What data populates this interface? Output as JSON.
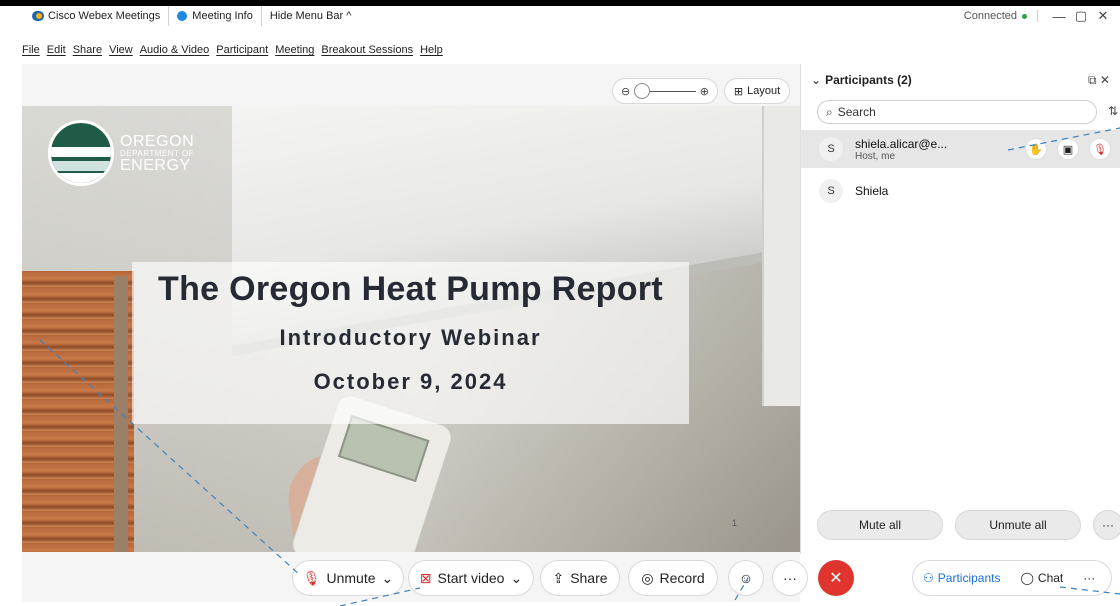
{
  "titlebar": {
    "app_name": "Cisco Webex Meetings",
    "meeting_info": "Meeting Info",
    "hide_menu": "Hide Menu Bar ^",
    "status": "Connected",
    "minimize": "—",
    "restore": "▢",
    "close": "✕"
  },
  "menu": [
    "File",
    "Edit",
    "Share",
    "View",
    "Audio & Video",
    "Participant",
    "Meeting",
    "Breakout Sessions",
    "Help"
  ],
  "stage": {
    "zoom_out_icon": "⊖",
    "zoom_in_icon": "⊕",
    "layout_label": "Layout"
  },
  "slide": {
    "logo_line1": "OREGON",
    "logo_line2": "DEPARTMENT OF",
    "logo_line3": "ENERGY",
    "title": "The Oregon Heat Pump Report",
    "subtitle": "Introductory Webinar",
    "date": "October 9, 2024",
    "page_number": "1"
  },
  "controls": {
    "unmute": "Unmute",
    "start_video": "Start video",
    "share": "Share",
    "record": "Record",
    "more": "···",
    "end": "✕",
    "participants_tab": "Participants",
    "chat_tab": "Chat",
    "tab_more": "···"
  },
  "panel": {
    "header": "Participants (2)",
    "search_placeholder": "Search",
    "participants": [
      {
        "initial": "S",
        "name": "shiela.alicar@e...",
        "sub": "Host, me"
      },
      {
        "initial": "S",
        "name": "Shiela",
        "sub": ""
      }
    ],
    "mute_all": "Mute all",
    "unmute_all": "Unmute all",
    "more": "···"
  },
  "colors": {
    "accent": "#1a6ed8",
    "danger": "#e0352f",
    "connected": "#2e9f43"
  }
}
